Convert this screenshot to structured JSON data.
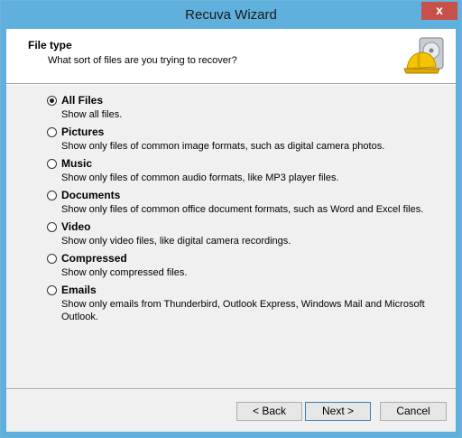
{
  "window": {
    "title": "Recuva Wizard",
    "close_glyph": "x"
  },
  "header": {
    "title": "File type",
    "subtitle": "What sort of files are you trying to recover?",
    "icon": "hard-hat-drive-icon"
  },
  "options": [
    {
      "label": "All Files",
      "desc": "Show all files.",
      "checked": true
    },
    {
      "label": "Pictures",
      "desc": "Show only files of common image formats, such as digital camera photos.",
      "checked": false
    },
    {
      "label": "Music",
      "desc": "Show only files of common audio formats, like MP3 player files.",
      "checked": false
    },
    {
      "label": "Documents",
      "desc": "Show only files of common office document formats, such as Word and Excel files.",
      "checked": false
    },
    {
      "label": "Video",
      "desc": "Show only video files, like digital camera recordings.",
      "checked": false
    },
    {
      "label": "Compressed",
      "desc": "Show only compressed files.",
      "checked": false
    },
    {
      "label": "Emails",
      "desc": "Show only emails from Thunderbird, Outlook Express, Windows Mail and Microsoft Outlook.",
      "checked": false
    }
  ],
  "buttons": {
    "back": "< Back",
    "next": "Next >",
    "cancel": "Cancel"
  },
  "colors": {
    "titlebar": "#5fb0dd",
    "close": "#c7504a",
    "client": "#f0f0f0"
  }
}
